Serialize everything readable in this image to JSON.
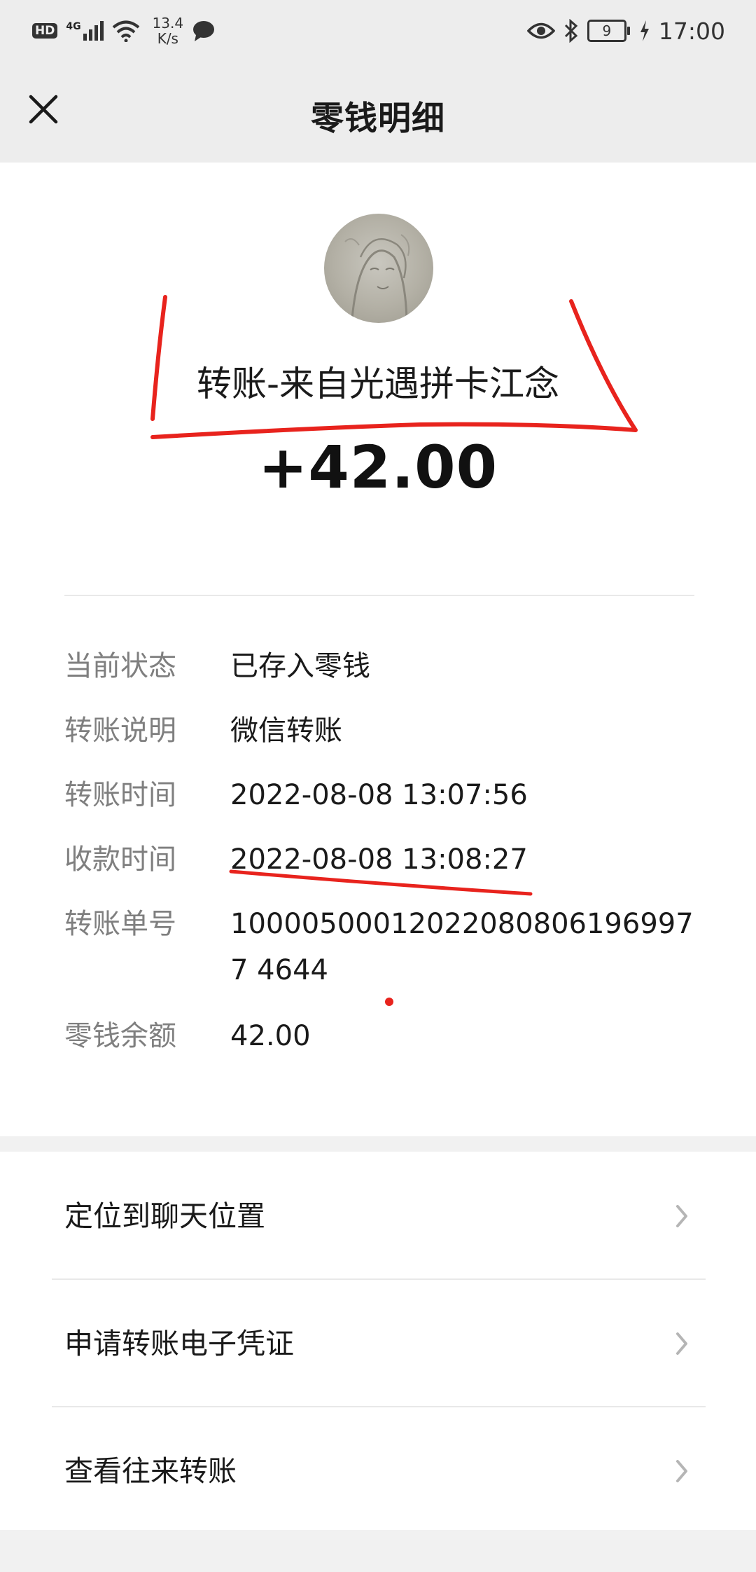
{
  "status_bar": {
    "hd": "HD",
    "network": "4G",
    "speed_value": "13.4",
    "speed_unit": "K/s",
    "battery": "9",
    "time": "17:00"
  },
  "header": {
    "title": "零钱明细"
  },
  "transfer": {
    "from_label": "转账-来自光遇拼卡江念",
    "amount": "+42.00"
  },
  "details": [
    {
      "label": "当前状态",
      "value": "已存入零钱"
    },
    {
      "label": "转账说明",
      "value": "微信转账"
    },
    {
      "label": "转账时间",
      "value": "2022-08-08 13:07:56"
    },
    {
      "label": "收款时间",
      "value": "2022-08-08 13:08:27"
    },
    {
      "label": "转账单号",
      "value": "100005000120220808061969977 4644"
    },
    {
      "label": "零钱余额",
      "value": "42.00"
    }
  ],
  "actions": [
    {
      "label": "定位到聊天位置"
    },
    {
      "label": "申请转账电子凭证"
    },
    {
      "label": "查看往来转账"
    }
  ],
  "colors": {
    "header_bg": "#ededed",
    "annotation_red": "#e8231d"
  }
}
